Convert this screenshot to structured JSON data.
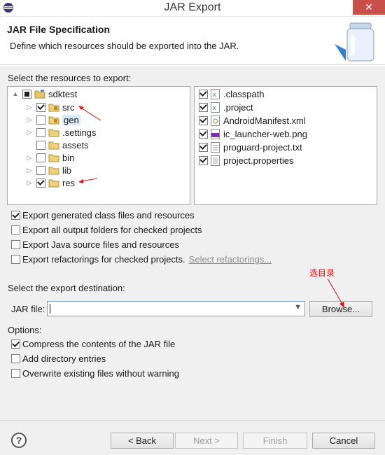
{
  "window": {
    "title": "JAR Export",
    "close_glyph": "✕"
  },
  "banner": {
    "title": "JAR File Specification",
    "description": "Define which resources should be exported into the JAR."
  },
  "resources": {
    "label": "Select the resources to export:",
    "tree": [
      {
        "label": "sdktest",
        "checkbox": "partial",
        "expander": "▲",
        "icon": "project-icon"
      },
      {
        "label": "src",
        "checkbox": "checked",
        "expander": "▷",
        "icon": "package-folder-icon"
      },
      {
        "label": "gen",
        "checkbox": "unchecked",
        "expander": "▷",
        "icon": "package-folder-icon"
      },
      {
        "label": ".settings",
        "checkbox": "unchecked",
        "expander": "▷",
        "icon": "folder-icon"
      },
      {
        "label": "assets",
        "checkbox": "unchecked",
        "expander": "",
        "icon": "folder-icon"
      },
      {
        "label": "bin",
        "checkbox": "unchecked",
        "expander": "▷",
        "icon": "folder-icon"
      },
      {
        "label": "lib",
        "checkbox": "unchecked",
        "expander": "▷",
        "icon": "folder-icon"
      },
      {
        "label": "res",
        "checkbox": "checked",
        "expander": "▷",
        "icon": "folder-icon"
      }
    ],
    "files": [
      {
        "label": ".classpath",
        "checked": true,
        "icon": "xml-file-icon"
      },
      {
        "label": ".project",
        "checked": true,
        "icon": "xml-file-icon"
      },
      {
        "label": "AndroidManifest.xml",
        "checked": true,
        "icon": "android-manifest-icon"
      },
      {
        "label": "ic_launcher-web.png",
        "checked": true,
        "icon": "image-file-icon"
      },
      {
        "label": "proguard-project.txt",
        "checked": true,
        "icon": "text-file-icon"
      },
      {
        "label": "project.properties",
        "checked": true,
        "icon": "text-file-icon"
      }
    ]
  },
  "export_options": {
    "generated_class": "Export generated class files and resources",
    "output_folders": "Export all output folders for checked projects",
    "java_source": "Export Java source files and resources",
    "refactorings": "Export refactorings for checked projects.",
    "select_refactorings": "Select refactorings..."
  },
  "destination": {
    "label": "Select the export destination:",
    "jar_file_label": "JAR file:",
    "jar_file_value": "",
    "browse_label": "Browse...",
    "annotation": "选目录"
  },
  "options": {
    "label": "Options:",
    "compress": "Compress the contents of the JAR file",
    "directory_entries": "Add directory entries",
    "overwrite": "Overwrite existing files without warning"
  },
  "footer": {
    "help_glyph": "?",
    "back_label": "< Back",
    "next_label": "Next >",
    "finish_label": "Finish",
    "cancel_label": "Cancel"
  },
  "colors": {
    "annotation": "#e01010",
    "close_button": "#c7504a",
    "selection": "#dbe9f8"
  }
}
